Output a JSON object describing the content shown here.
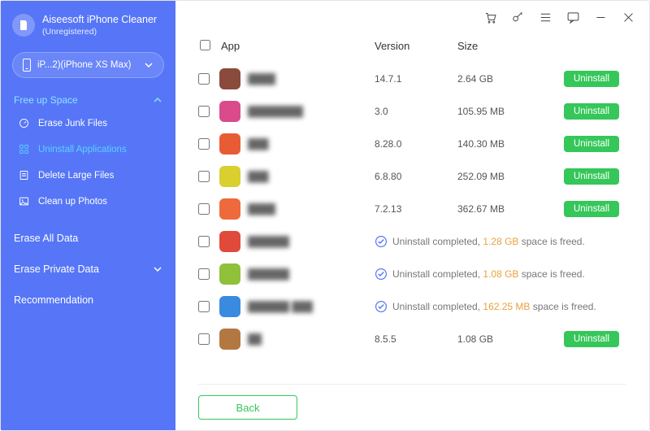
{
  "brand": {
    "title": "Aiseesoft iPhone Cleaner",
    "subtitle": "(Unregistered)"
  },
  "device": {
    "label": "iP...2)(iPhone XS Max)"
  },
  "sidebar": {
    "freeUp": {
      "header": "Free up Space",
      "items": [
        {
          "label": "Erase Junk Files",
          "icon": "gauge-icon"
        },
        {
          "label": "Uninstall Applications",
          "icon": "app-icon"
        },
        {
          "label": "Delete Large Files",
          "icon": "file-icon"
        },
        {
          "label": "Clean up Photos",
          "icon": "image-icon"
        }
      ]
    },
    "eraseAll": "Erase All Data",
    "erasePrivate": "Erase Private Data",
    "recommendation": "Recommendation"
  },
  "columns": {
    "app": "App",
    "version": "Version",
    "size": "Size"
  },
  "buttons": {
    "uninstall": "Uninstall",
    "back": "Back"
  },
  "status": {
    "prefix": "Uninstall completed, ",
    "suffix": " space is freed."
  },
  "rows": [
    {
      "color": "#8a4a3c",
      "name": "████",
      "version": "14.7.1",
      "size": "2.64 GB"
    },
    {
      "color": "#d94b8a",
      "name": "████████",
      "version": "3.0",
      "size": "105.95 MB"
    },
    {
      "color": "#e85c35",
      "name": "███",
      "version": "8.28.0",
      "size": "140.30 MB"
    },
    {
      "color": "#d9cf2e",
      "name": "███",
      "version": "6.8.80",
      "size": "252.09 MB"
    },
    {
      "color": "#ee6a3c",
      "name": "████",
      "version": "7.2.13",
      "size": "362.67 MB"
    },
    {
      "color": "#e04a3a",
      "name": "██████",
      "completed": true,
      "freed": "1.28 GB"
    },
    {
      "color": "#8fc13a",
      "name": "██████",
      "completed": true,
      "freed": "1.08 GB"
    },
    {
      "color": "#3a8ae0",
      "name": "██████ ███",
      "completed": true,
      "freed": "162.25 MB"
    },
    {
      "color": "#b37842",
      "name": "██",
      "version": "8.5.5",
      "size": "1.08 GB"
    }
  ]
}
